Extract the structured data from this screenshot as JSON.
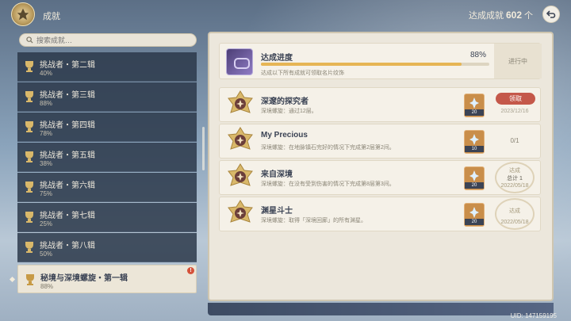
{
  "header": {
    "title": "成就",
    "total_label": "达成成就",
    "total_count": "602",
    "total_unit": "个"
  },
  "search": {
    "placeholder": "搜索成就…"
  },
  "categories": [
    {
      "name": "挑战者・第二辑",
      "percent": "40%"
    },
    {
      "name": "挑战者・第三辑",
      "percent": "88%"
    },
    {
      "name": "挑战者・第四辑",
      "percent": "78%"
    },
    {
      "name": "挑战者・第五辑",
      "percent": "38%"
    },
    {
      "name": "挑战者・第六辑",
      "percent": "75%"
    },
    {
      "name": "挑战者・第七辑",
      "percent": "25%"
    },
    {
      "name": "挑战者・第八辑",
      "percent": "50%"
    },
    {
      "name": "秘境与深境螺旋・第一辑",
      "percent": "88%",
      "selected": true,
      "alert": "!"
    }
  ],
  "progress": {
    "title": "达成进度",
    "percent": "88%",
    "percent_value": 0.88,
    "subtitle": "达成以下所有成就可领取名片纹饰",
    "status": "进行中"
  },
  "achievements": [
    {
      "title": "深邃的探究者",
      "desc": "深境螺旋：通过12层。",
      "reward_qty": "20",
      "action": "领取",
      "date": "2023/12/16"
    },
    {
      "title": "My Precious",
      "desc": "深境螺旋：在地脉镇石完好的情况下完成第2层第2间。",
      "reward_qty": "10",
      "progress": "0/1"
    },
    {
      "title": "来自深境",
      "desc": "深境螺旋：在没有受到伤害的情况下完成第8层第3间。",
      "reward_qty": "20",
      "stamp": "达成",
      "stamp_extra": "总计 1",
      "date": "2022/05/18"
    },
    {
      "title": "渊星斗士",
      "desc": "深境螺旋：取得「深境回廊」的所有渊星。",
      "reward_qty": "20",
      "stamp": "达成",
      "date": "2022/05/18"
    }
  ],
  "footer": {
    "uid": "UID: 147159195"
  },
  "colors": {
    "accent_gold": "#e6b554",
    "claim_red": "#c4584a",
    "sidebar_dark": "#2c384a"
  }
}
